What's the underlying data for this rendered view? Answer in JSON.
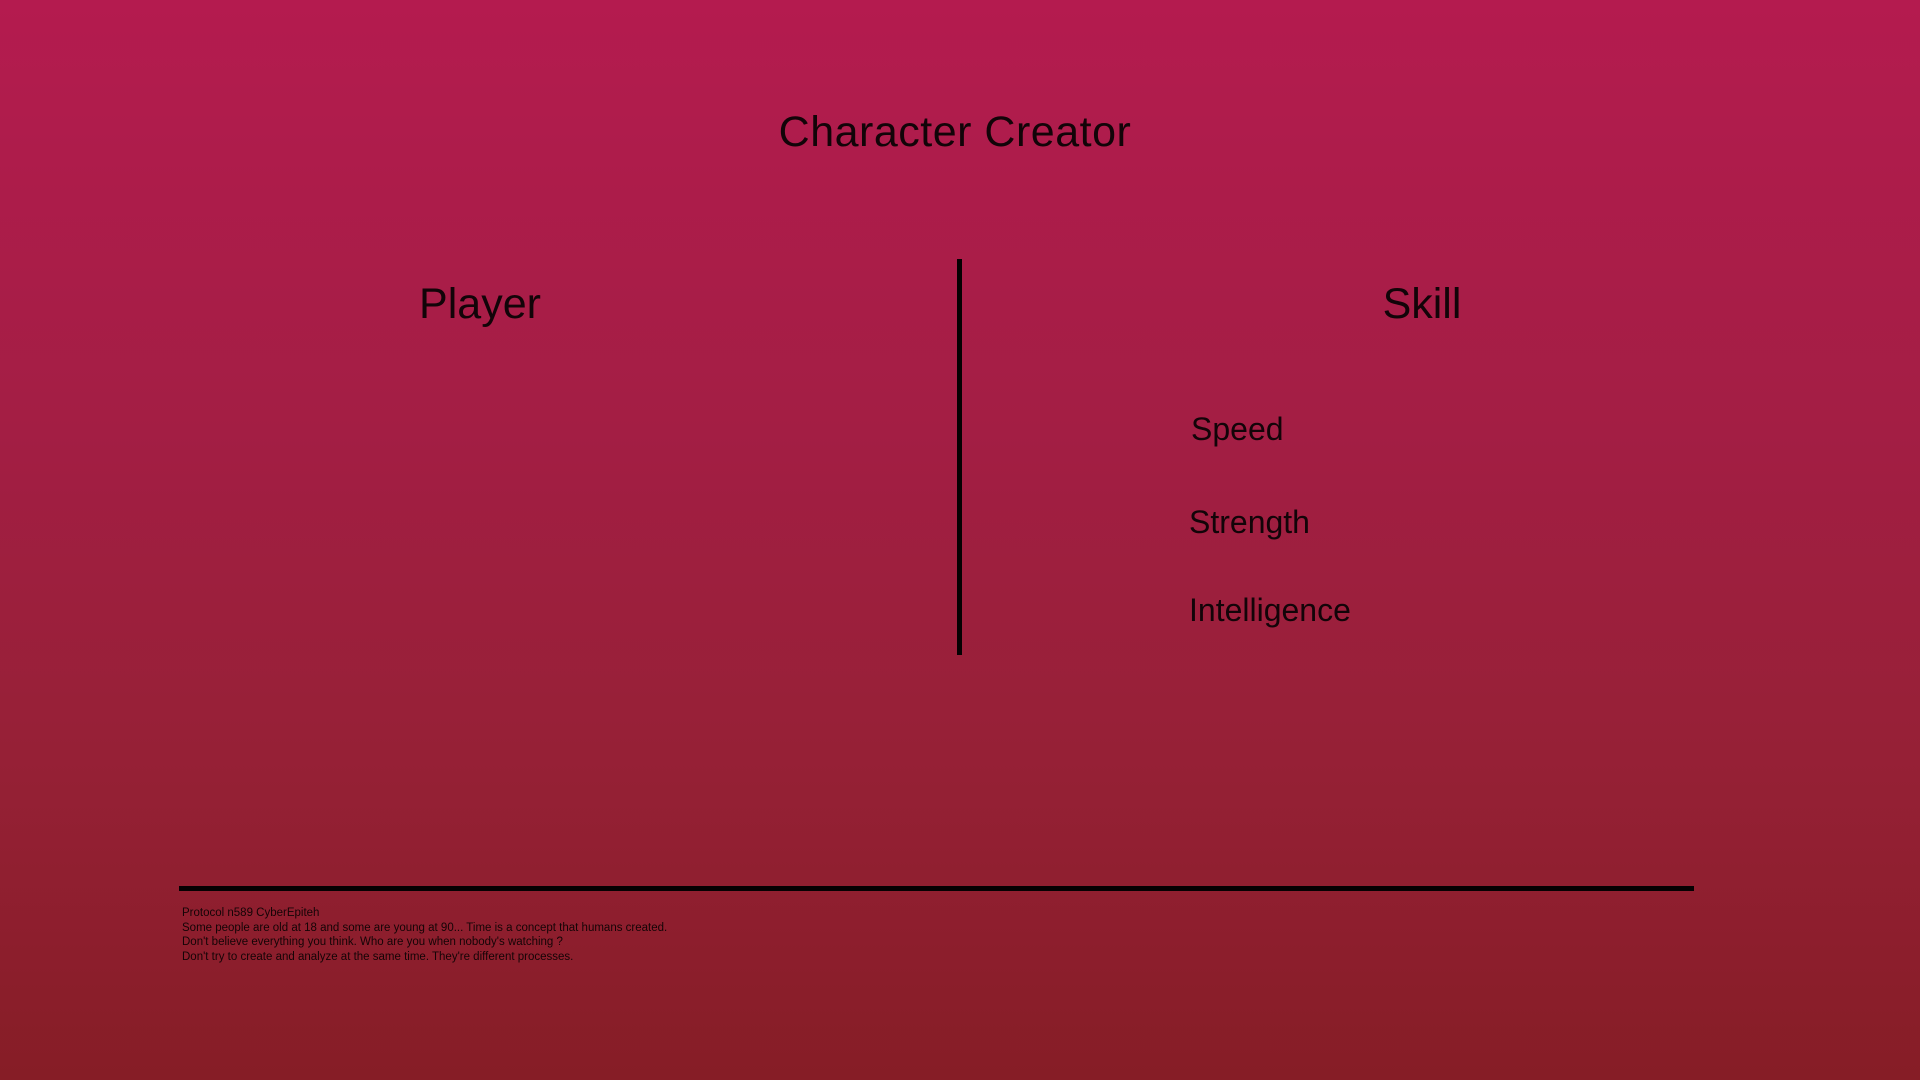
{
  "header": {
    "title": "Character Creator"
  },
  "player": {
    "heading": "Player"
  },
  "skill": {
    "heading": "Skill",
    "items": [
      {
        "label": "Speed"
      },
      {
        "label": "Strength"
      },
      {
        "label": "Intelligence"
      }
    ]
  },
  "footer": {
    "lines": [
      "Protocol n589 CyberEpiteh",
      "Some people are old at 18 and some are young at 90... Time is a concept that humans created.",
      "Don't believe everything you think. Who are you when nobody's watching ?",
      "Don't try to create and analyze at the same time. They're different processes."
    ]
  },
  "colors": {
    "background_top": "#b41b4f",
    "background_bottom": "#861d26",
    "text": "#120408",
    "divider": "#050102"
  }
}
